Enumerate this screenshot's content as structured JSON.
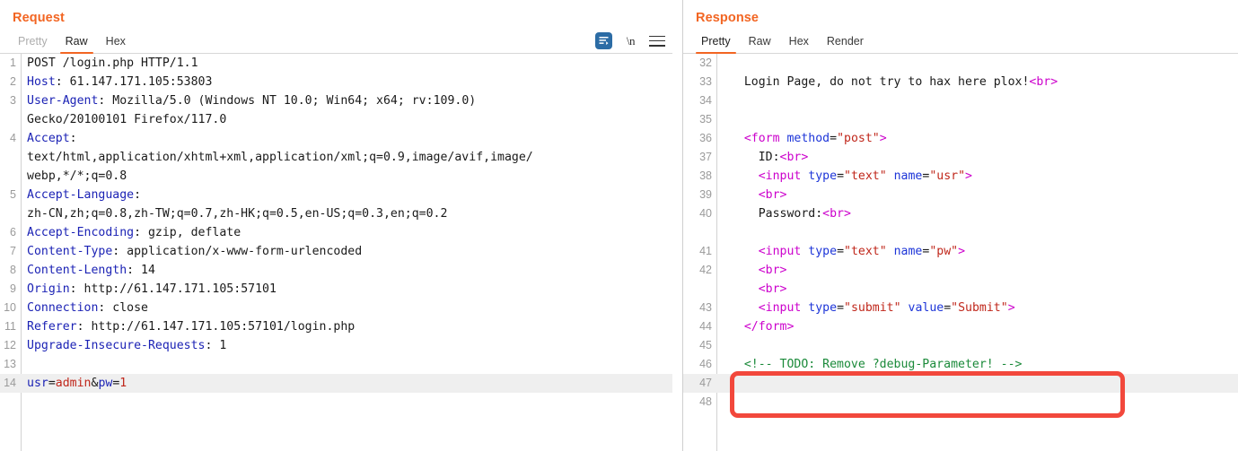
{
  "request": {
    "title": "Request",
    "tabs": [
      {
        "label": "Pretty",
        "active": false,
        "muted": true
      },
      {
        "label": "Raw",
        "active": true,
        "muted": false
      },
      {
        "label": "Hex",
        "active": false,
        "muted": false
      }
    ],
    "tools": [
      {
        "name": "word-wrap-icon",
        "label": ""
      },
      {
        "name": "newline-toggle",
        "label": "\\n"
      },
      {
        "name": "menu-icon",
        "label": ""
      }
    ],
    "lines": [
      {
        "n": "1",
        "highlight": false,
        "tokens": [
          {
            "t": "POST /login.php HTTP/1.1",
            "c": "k-plain"
          }
        ]
      },
      {
        "n": "2",
        "highlight": false,
        "tokens": [
          {
            "t": "Host",
            "c": "k-header"
          },
          {
            "t": ": 61.147.171.105:53803",
            "c": "k-plain"
          }
        ]
      },
      {
        "n": "3",
        "highlight": false,
        "tokens": [
          {
            "t": "User-Agent",
            "c": "k-header"
          },
          {
            "t": ": Mozilla/5.0 (Windows NT 10.0; Win64; x64; rv:109.0)",
            "c": "k-plain"
          }
        ]
      },
      {
        "n": "",
        "highlight": false,
        "tokens": [
          {
            "t": "Gecko/20100101 Firefox/117.0",
            "c": "k-plain"
          }
        ]
      },
      {
        "n": "4",
        "highlight": false,
        "tokens": [
          {
            "t": "Accept",
            "c": "k-header"
          },
          {
            "t": ":",
            "c": "k-plain"
          }
        ]
      },
      {
        "n": "",
        "highlight": false,
        "tokens": [
          {
            "t": "text/html,application/xhtml+xml,application/xml;q=0.9,image/avif,image/",
            "c": "k-plain"
          }
        ]
      },
      {
        "n": "",
        "highlight": false,
        "tokens": [
          {
            "t": "webp,*/*;q=0.8",
            "c": "k-plain"
          }
        ]
      },
      {
        "n": "5",
        "highlight": false,
        "tokens": [
          {
            "t": "Accept-Language",
            "c": "k-header"
          },
          {
            "t": ":",
            "c": "k-plain"
          }
        ]
      },
      {
        "n": "",
        "highlight": false,
        "tokens": [
          {
            "t": "zh-CN,zh;q=0.8,zh-TW;q=0.7,zh-HK;q=0.5,en-US;q=0.3,en;q=0.2",
            "c": "k-plain"
          }
        ]
      },
      {
        "n": "6",
        "highlight": false,
        "tokens": [
          {
            "t": "Accept-Encoding",
            "c": "k-header"
          },
          {
            "t": ": gzip, deflate",
            "c": "k-plain"
          }
        ]
      },
      {
        "n": "7",
        "highlight": false,
        "tokens": [
          {
            "t": "Content-Type",
            "c": "k-header"
          },
          {
            "t": ": application/x-www-form-urlencoded",
            "c": "k-plain"
          }
        ]
      },
      {
        "n": "8",
        "highlight": false,
        "tokens": [
          {
            "t": "Content-Length",
            "c": "k-header"
          },
          {
            "t": ": 14",
            "c": "k-plain"
          }
        ]
      },
      {
        "n": "9",
        "highlight": false,
        "tokens": [
          {
            "t": "Origin",
            "c": "k-header"
          },
          {
            "t": ": http://61.147.171.105:57101",
            "c": "k-plain"
          }
        ]
      },
      {
        "n": "10",
        "highlight": false,
        "tokens": [
          {
            "t": "Connection",
            "c": "k-header"
          },
          {
            "t": ": close",
            "c": "k-plain"
          }
        ]
      },
      {
        "n": "11",
        "highlight": false,
        "tokens": [
          {
            "t": "Referer",
            "c": "k-header"
          },
          {
            "t": ": http://61.147.171.105:57101/login.php",
            "c": "k-plain"
          }
        ]
      },
      {
        "n": "12",
        "highlight": false,
        "tokens": [
          {
            "t": "Upgrade-Insecure-Requests",
            "c": "k-header"
          },
          {
            "t": ": 1",
            "c": "k-plain"
          }
        ]
      },
      {
        "n": "13",
        "highlight": false,
        "tokens": [
          {
            "t": "",
            "c": "k-plain"
          }
        ]
      },
      {
        "n": "14",
        "highlight": true,
        "tokens": [
          {
            "t": "usr",
            "c": "k-header"
          },
          {
            "t": "=",
            "c": "k-plain"
          },
          {
            "t": "admin",
            "c": "k-param"
          },
          {
            "t": "&",
            "c": "k-plain"
          },
          {
            "t": "pw",
            "c": "k-header"
          },
          {
            "t": "=",
            "c": "k-plain"
          },
          {
            "t": "1",
            "c": "k-param"
          }
        ]
      },
      {
        "n": "",
        "highlight": false,
        "tokens": [
          {
            "t": "",
            "c": "k-plain"
          }
        ]
      }
    ]
  },
  "response": {
    "title": "Response",
    "tabs": [
      {
        "label": "Pretty",
        "active": true,
        "muted": false
      },
      {
        "label": "Raw",
        "active": false,
        "muted": false
      },
      {
        "label": "Hex",
        "active": false,
        "muted": false
      },
      {
        "label": "Render",
        "active": false,
        "muted": false
      }
    ],
    "lines": [
      {
        "n": "32",
        "highlight": false,
        "tokens": [
          {
            "t": "",
            "c": "k-plain"
          }
        ]
      },
      {
        "n": "33",
        "highlight": false,
        "tokens": [
          {
            "t": "   Login Page, do not try to hax here plox!",
            "c": "k-plain"
          },
          {
            "t": "<",
            "c": "k-tag"
          },
          {
            "t": "br",
            "c": "k-tag"
          },
          {
            "t": ">",
            "c": "k-tag"
          }
        ]
      },
      {
        "n": "34",
        "highlight": false,
        "tokens": [
          {
            "t": "",
            "c": "k-plain"
          }
        ]
      },
      {
        "n": "35",
        "highlight": false,
        "tokens": [
          {
            "t": "",
            "c": "k-plain"
          }
        ]
      },
      {
        "n": "36",
        "highlight": false,
        "tokens": [
          {
            "t": "   ",
            "c": "k-plain"
          },
          {
            "t": "<form",
            "c": "k-tag"
          },
          {
            "t": " ",
            "c": "k-plain"
          },
          {
            "t": "method",
            "c": "k-attr"
          },
          {
            "t": "=",
            "c": "k-plain"
          },
          {
            "t": "\"post\"",
            "c": "k-str"
          },
          {
            "t": ">",
            "c": "k-tag"
          }
        ]
      },
      {
        "n": "37",
        "highlight": false,
        "tokens": [
          {
            "t": "     ID:",
            "c": "k-plain"
          },
          {
            "t": "<br>",
            "c": "k-tag"
          }
        ]
      },
      {
        "n": "38",
        "highlight": false,
        "tokens": [
          {
            "t": "     ",
            "c": "k-plain"
          },
          {
            "t": "<input",
            "c": "k-tag"
          },
          {
            "t": " ",
            "c": "k-plain"
          },
          {
            "t": "type",
            "c": "k-attr"
          },
          {
            "t": "=",
            "c": "k-plain"
          },
          {
            "t": "\"text\"",
            "c": "k-str"
          },
          {
            "t": " ",
            "c": "k-plain"
          },
          {
            "t": "name",
            "c": "k-attr"
          },
          {
            "t": "=",
            "c": "k-plain"
          },
          {
            "t": "\"usr\"",
            "c": "k-str"
          },
          {
            "t": ">",
            "c": "k-tag"
          }
        ]
      },
      {
        "n": "39",
        "highlight": false,
        "tokens": [
          {
            "t": "     ",
            "c": "k-plain"
          },
          {
            "t": "<br>",
            "c": "k-tag"
          }
        ]
      },
      {
        "n": "40",
        "highlight": false,
        "tokens": [
          {
            "t": "     Password:",
            "c": "k-plain"
          },
          {
            "t": "<br>",
            "c": "k-tag"
          }
        ]
      },
      {
        "n": "",
        "highlight": false,
        "tokens": [
          {
            "t": "",
            "c": "k-plain"
          }
        ]
      },
      {
        "n": "41",
        "highlight": false,
        "tokens": [
          {
            "t": "     ",
            "c": "k-plain"
          },
          {
            "t": "<input",
            "c": "k-tag"
          },
          {
            "t": " ",
            "c": "k-plain"
          },
          {
            "t": "type",
            "c": "k-attr"
          },
          {
            "t": "=",
            "c": "k-plain"
          },
          {
            "t": "\"text\"",
            "c": "k-str"
          },
          {
            "t": " ",
            "c": "k-plain"
          },
          {
            "t": "name",
            "c": "k-attr"
          },
          {
            "t": "=",
            "c": "k-plain"
          },
          {
            "t": "\"pw\"",
            "c": "k-str"
          },
          {
            "t": ">",
            "c": "k-tag"
          }
        ]
      },
      {
        "n": "42",
        "highlight": false,
        "tokens": [
          {
            "t": "     ",
            "c": "k-plain"
          },
          {
            "t": "<br>",
            "c": "k-tag"
          }
        ]
      },
      {
        "n": "",
        "highlight": false,
        "tokens": [
          {
            "t": "     ",
            "c": "k-plain"
          },
          {
            "t": "<br>",
            "c": "k-tag"
          }
        ]
      },
      {
        "n": "43",
        "highlight": false,
        "tokens": [
          {
            "t": "     ",
            "c": "k-plain"
          },
          {
            "t": "<input",
            "c": "k-tag"
          },
          {
            "t": " ",
            "c": "k-plain"
          },
          {
            "t": "type",
            "c": "k-attr"
          },
          {
            "t": "=",
            "c": "k-plain"
          },
          {
            "t": "\"submit\"",
            "c": "k-str"
          },
          {
            "t": " ",
            "c": "k-plain"
          },
          {
            "t": "value",
            "c": "k-attr"
          },
          {
            "t": "=",
            "c": "k-plain"
          },
          {
            "t": "\"Submit\"",
            "c": "k-str"
          },
          {
            "t": ">",
            "c": "k-tag"
          }
        ]
      },
      {
        "n": "44",
        "highlight": false,
        "tokens": [
          {
            "t": "   ",
            "c": "k-plain"
          },
          {
            "t": "</form>",
            "c": "k-tag"
          }
        ]
      },
      {
        "n": "45",
        "highlight": false,
        "tokens": [
          {
            "t": "",
            "c": "k-plain"
          }
        ]
      },
      {
        "n": "46",
        "highlight": false,
        "tokens": [
          {
            "t": "   <!-- TODO: Remove ?debug-Parameter! -->",
            "c": "k-comment"
          }
        ]
      },
      {
        "n": "47",
        "highlight": true,
        "tokens": [
          {
            "t": "",
            "c": "k-plain"
          }
        ]
      },
      {
        "n": "48",
        "highlight": false,
        "tokens": [
          {
            "t": "",
            "c": "k-plain"
          }
        ]
      }
    ],
    "annotation": {
      "name": "todo-comment-highlight-box",
      "color": "#f2483c"
    }
  }
}
